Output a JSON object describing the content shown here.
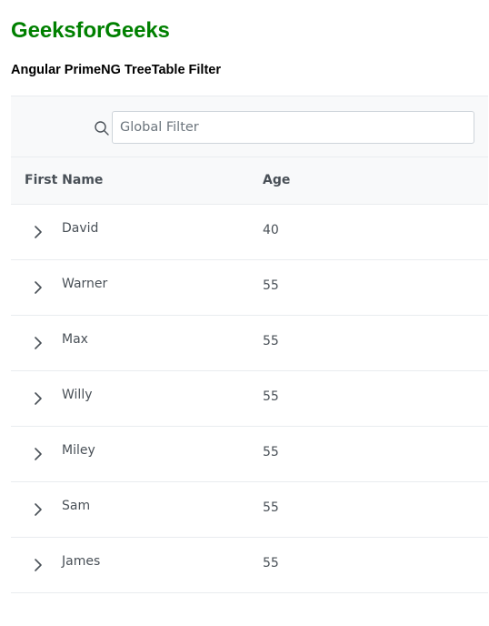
{
  "header": {
    "brand": "GeeksforGeeks",
    "subtitle": "Angular PrimeNG TreeTable Filter"
  },
  "filter": {
    "placeholder": "Global Filter",
    "value": "",
    "icon": "search-icon"
  },
  "table": {
    "columns": [
      "First Name",
      "Age"
    ],
    "rows": [
      {
        "name": "David",
        "age": "40"
      },
      {
        "name": "Warner",
        "age": "55"
      },
      {
        "name": "Max",
        "age": "55"
      },
      {
        "name": "Willy",
        "age": "55"
      },
      {
        "name": "Miley",
        "age": "55"
      },
      {
        "name": "Sam",
        "age": "55"
      },
      {
        "name": "James",
        "age": "55"
      }
    ],
    "row_icon": "chevron-right-icon"
  },
  "colors": {
    "brand": "#008000",
    "text": "#495057",
    "header_bg": "#f8f9fa",
    "border": "#e9ecef"
  }
}
